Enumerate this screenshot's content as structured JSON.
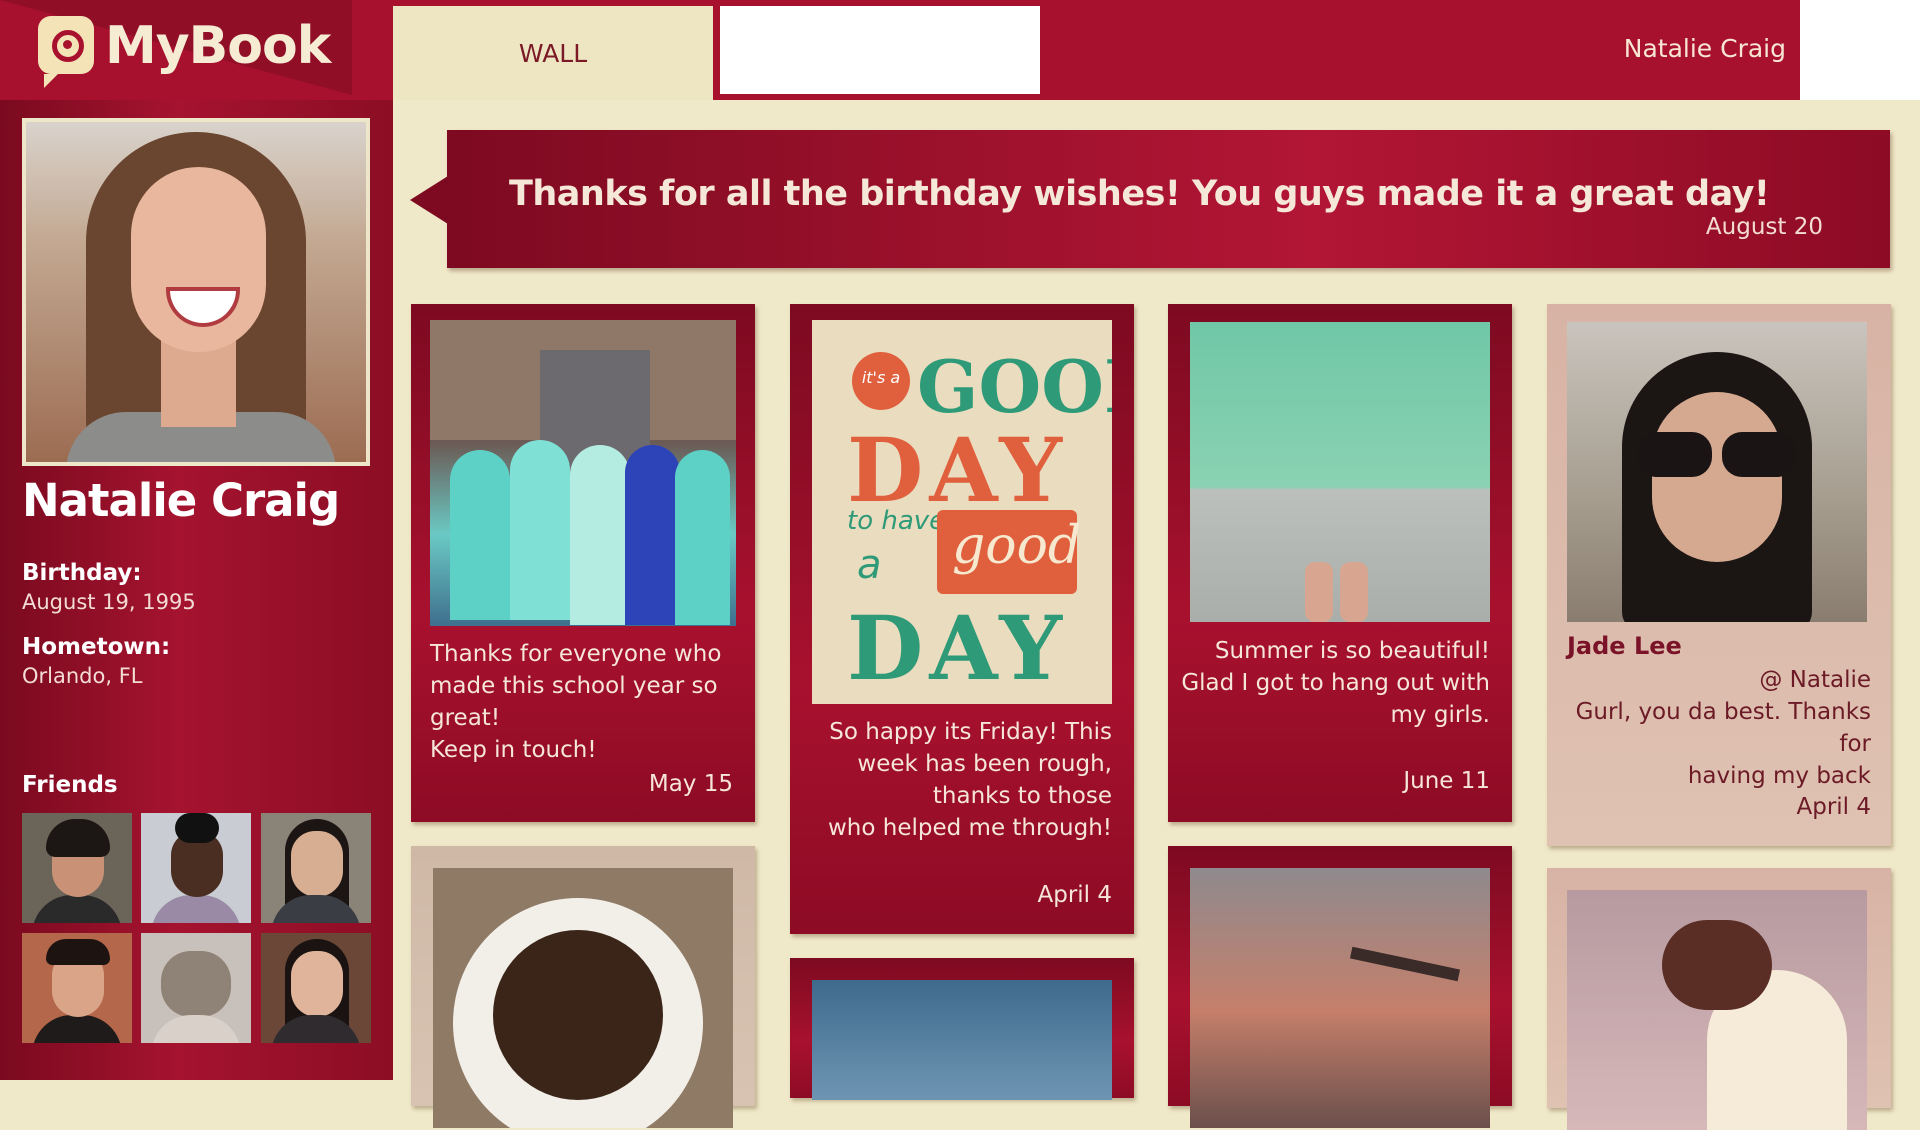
{
  "app": {
    "name": "MyBook",
    "tabs": [
      {
        "label": "WALL"
      },
      {
        "label": ""
      }
    ],
    "current_user": "Natalie Craig"
  },
  "profile": {
    "name": "Natalie Craig",
    "birthday_label": "Birthday:",
    "birthday": "August 19, 1995",
    "hometown_label": "Hometown:",
    "hometown": "Orlando, FL",
    "friends_label": "Friends"
  },
  "status": {
    "text": "Thanks for all the birthday wishes! You guys made it a great day!",
    "date": "August 20"
  },
  "posts": [
    {
      "caption_lines": [
        "Thanks for everyone who",
        "made this school year so",
        "great!",
        "Keep in touch!"
      ],
      "date": "May 15"
    },
    {
      "poster": {
        "its_a": "it's a",
        "good": "GOOD",
        "day": "DAY",
        "to_have": "to have",
        "a": "a",
        "good2": "good",
        "day2": "DAY"
      },
      "caption_lines": [
        "So happy its Friday! This",
        "week has been rough,",
        "thanks to those",
        "who helped me through!"
      ],
      "date": "April 4"
    },
    {
      "caption_lines": [
        "Summer is so beautiful!",
        "Glad I got to hang out with",
        "my girls."
      ],
      "date": "June 11"
    },
    {
      "author": "Jade Lee",
      "caption_lines": [
        "@ Natalie",
        "Gurl, you da best. Thanks for",
        "having my back"
      ],
      "date": "April 4"
    }
  ]
}
